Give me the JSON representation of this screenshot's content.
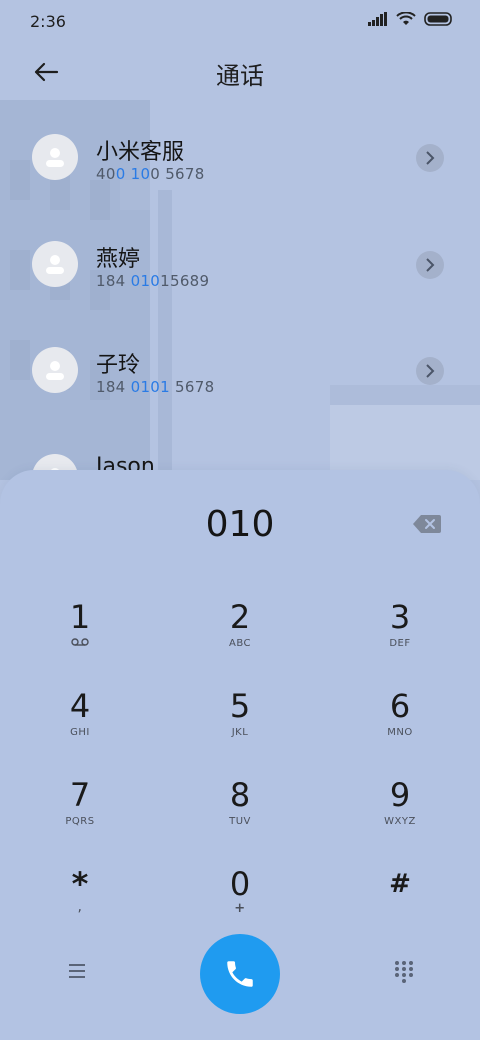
{
  "status": {
    "time": "2:36",
    "icons": [
      "signal-icon",
      "wifi-icon",
      "battery-icon"
    ]
  },
  "header": {
    "title": "通话",
    "back_icon": "arrow-left-icon"
  },
  "contacts": [
    {
      "name": "小米客服",
      "number_parts": [
        {
          "t": "40",
          "hl": false
        },
        {
          "t": "0",
          "hl": true
        },
        {
          "t": " ",
          "hl": false
        },
        {
          "t": "10",
          "hl": true
        },
        {
          "t": "0 5678",
          "hl": false
        }
      ]
    },
    {
      "name": "燕婷",
      "number_parts": [
        {
          "t": "184 ",
          "hl": false
        },
        {
          "t": "010",
          "hl": true
        },
        {
          "t": "15689",
          "hl": false
        }
      ]
    },
    {
      "name": "子玲",
      "number_parts": [
        {
          "t": "184 ",
          "hl": false
        },
        {
          "t": "0101",
          "hl": true
        },
        {
          "t": " 5678",
          "hl": false
        }
      ]
    },
    {
      "name": "Jason",
      "number_parts": []
    }
  ],
  "dialer": {
    "input": "010",
    "keys": [
      {
        "num": "1",
        "sub": "voicemail-icon"
      },
      {
        "num": "2",
        "sub": "ABC"
      },
      {
        "num": "3",
        "sub": "DEF"
      },
      {
        "num": "4",
        "sub": "GHI"
      },
      {
        "num": "5",
        "sub": "JKL"
      },
      {
        "num": "6",
        "sub": "MNO"
      },
      {
        "num": "7",
        "sub": "PQRS"
      },
      {
        "num": "8",
        "sub": "TUV"
      },
      {
        "num": "9",
        "sub": "WXYZ"
      },
      {
        "num": "*",
        "sub": ","
      },
      {
        "num": "0",
        "sub": "+"
      },
      {
        "num": "#",
        "sub": ""
      }
    ]
  },
  "bottom": {
    "menu_icon": "menu-icon",
    "call_icon": "phone-icon",
    "keypad_icon": "keypad-grid-icon"
  },
  "colors": {
    "accent": "#1f9bf0",
    "highlight": "#2a7be5",
    "background": "#b4c3e1"
  }
}
